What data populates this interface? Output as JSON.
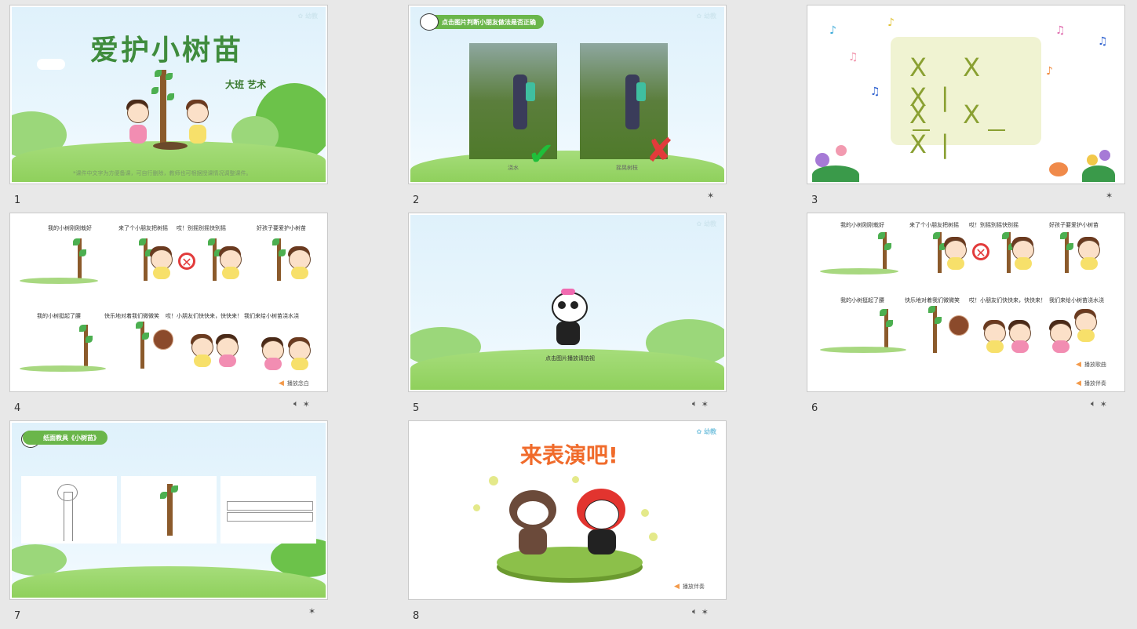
{
  "slides": [
    {
      "number": "1",
      "title": "爱护小树苗",
      "subtitle": "大班  艺术",
      "note": "*课件中文字为方便备课，可自行删除，教师也可根据授课情况调整课件。",
      "meta": ""
    },
    {
      "number": "2",
      "banner": "点击图片判断小朋友做法是否正确",
      "captions": [
        "浇水",
        "摇晃树枝"
      ],
      "meta": "✶"
    },
    {
      "number": "3",
      "rows": [
        "X  X  X|",
        "X  X  X|"
      ],
      "meta": "✶"
    },
    {
      "number": "4",
      "lyrics_top": [
        "我的小树刚刚栽好",
        "来了个小朋友把树摇",
        "哎！别摇别摇快别摇",
        "好孩子要爱护小树苗"
      ],
      "lyrics_bottom": [
        "我的小树挺起了腰",
        "快乐地对着我们微微笑",
        "哎！小朋友们快快来，快快来！",
        "我们来给小树苗浇水浇"
      ],
      "audio_label": "播放念白",
      "meta": "✶"
    },
    {
      "number": "5",
      "caption": "点击图片播放请拍视",
      "meta": "✶"
    },
    {
      "number": "6",
      "lyrics_top": [
        "我的小树刚刚栽好",
        "来了个小朋友把树摇",
        "哎！别摇别摇快别摇",
        "好孩子要爱护小树苗"
      ],
      "lyrics_bottom": [
        "我的小树挺起了腰",
        "快乐地对着我们微微笑",
        "哎！小朋友们快快来，快快来！",
        "我们来给小树苗浇水浇"
      ],
      "audio_labels": [
        "播放歌曲",
        "播放伴奏"
      ],
      "meta": "✶"
    },
    {
      "number": "7",
      "banner": "纸面教具《小树苗》",
      "meta": "✶"
    },
    {
      "number": "8",
      "title": "来表演吧!",
      "audio_label": "播放伴奏",
      "meta": "✶"
    }
  ],
  "icons": {
    "speaker": "speaker-icon",
    "star": "star-icon"
  },
  "colors": {
    "background": "#e8e8e8",
    "title_green": "#3f8c3d",
    "grass": "#8fd05c",
    "sky": "#dff1fb",
    "perform_orange": "#f06b2b",
    "check_green": "#1fbf3a",
    "cross_red": "#e23b3b"
  }
}
